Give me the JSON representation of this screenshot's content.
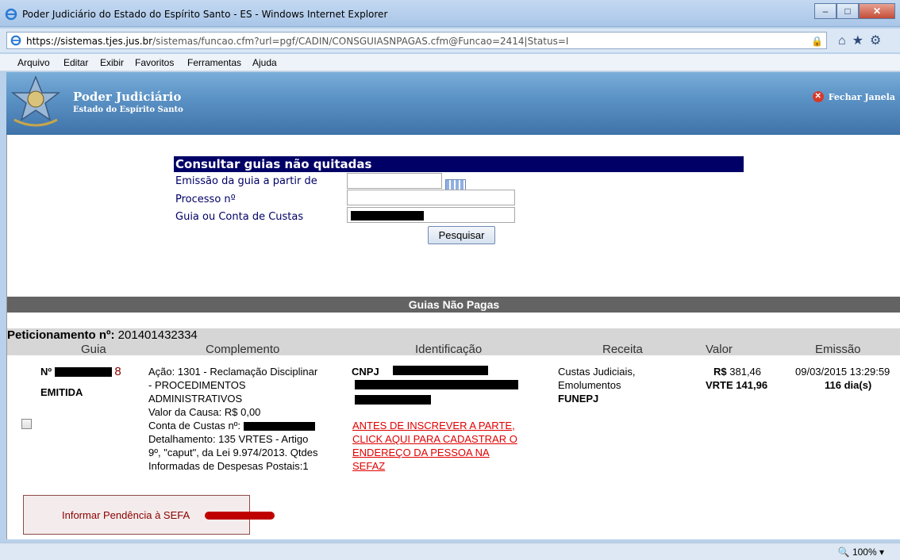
{
  "window": {
    "title": "Poder Judiciário do Estado do Espírito Santo - ES - Windows Internet Explorer",
    "url_host": "https://sistemas.tjes.jus.br",
    "url_path": "/sistemas/funcao.cfm?url=pgf/CADIN/CONSGUIASNPAGAS.cfm@Funcao=2414|Status=I"
  },
  "menu": [
    "Arquivo",
    "Editar",
    "Exibir",
    "Favoritos",
    "Ferramentas",
    "Ajuda"
  ],
  "banner": {
    "title": "Poder Judiciário",
    "subtitle": "Estado do Espírito Santo",
    "close_label": "Fechar Janela"
  },
  "form": {
    "header": "Consultar guias não quitadas",
    "label_emissao": "Emissão da guia a partir de",
    "label_processo": "Processo nº",
    "label_guia": "Guia ou Conta de Custas",
    "search_button": "Pesquisar"
  },
  "section_title": "Guias Não Pagas",
  "peticionamento": {
    "label": "Peticionamento nº:",
    "value": "201401432334"
  },
  "columns": [
    "Guia",
    "Complemento",
    "Identificação",
    "Receita",
    "Valor",
    "Emissão"
  ],
  "row": {
    "guia_prefix": "Nº",
    "guia_suffix": "8",
    "status": "EMITIDA",
    "complemento": [
      "Ação: 1301 - Reclamação Disciplinar",
      "- PROCEDIMENTOS",
      "ADMINISTRATIVOS",
      "Valor da Causa: R$ 0,00",
      "Conta de Custas nº:",
      "Detalhamento: 135 VRTES - Artigo",
      "9º, \"caput\", da Lei 9.974/2013. Qtdes",
      "Informadas de Despesas Postais:1"
    ],
    "ident_label": "CNPJ",
    "ident_link": [
      "ANTES DE INSCREVER A PARTE,",
      "CLICK AQUI PARA CADASTRAR O",
      "ENDEREÇO DA PESSOA NA",
      "SEFAZ"
    ],
    "receita": [
      "Custas Judiciais,",
      "Emolumentos",
      "FUNEPJ"
    ],
    "valor_currency": "R$",
    "valor": "381,46",
    "vrte": "VRTE 141,96",
    "emissao": "09/03/2015 13:29:59",
    "dias": "116 dia(s)"
  },
  "inform_button": "Informar Pendência à SEFA",
  "status": {
    "zoom": "100%"
  }
}
